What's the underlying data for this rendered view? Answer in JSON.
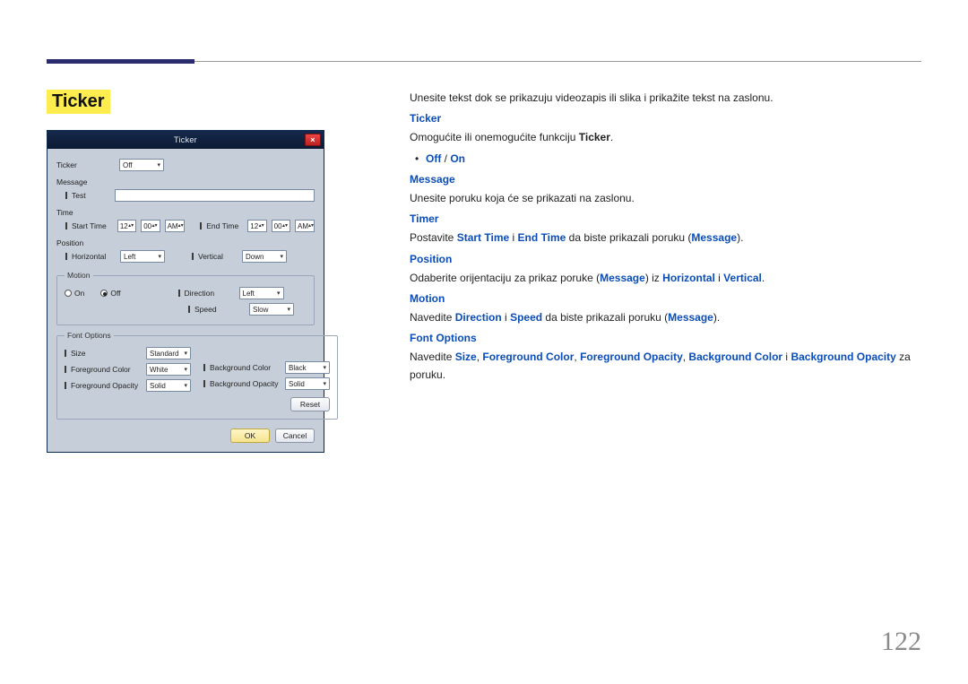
{
  "page_number": "122",
  "heading": "Ticker",
  "dialog": {
    "title": "Ticker",
    "close_glyph": "×",
    "labels": {
      "ticker": "Ticker",
      "message": "Message",
      "test": "Test",
      "time": "Time",
      "start_time": "Start Time",
      "end_time": "End Time",
      "position": "Position",
      "horizontal": "Horizontal",
      "vertical": "Vertical",
      "motion": "Motion",
      "on": "On",
      "off": "Off",
      "direction": "Direction",
      "speed": "Speed",
      "font_options": "Font Options",
      "size": "Size",
      "fg_color": "Foreground Color",
      "fg_opacity": "Foreground Opacity",
      "bg_color": "Background Color",
      "bg_opacity": "Background Opacity"
    },
    "values": {
      "ticker": "Off",
      "message_text": "",
      "start_hh": "12",
      "start_mm": "00",
      "start_ampm": "AM",
      "end_hh": "12",
      "end_mm": "00",
      "end_ampm": "AM",
      "horizontal": "Left",
      "vertical": "Down",
      "motion_on": false,
      "direction": "Left",
      "speed": "Slow",
      "size": "Standard",
      "fg_color": "White",
      "fg_opacity": "Solid",
      "bg_color": "Black",
      "bg_opacity": "Solid"
    },
    "buttons": {
      "reset": "Reset",
      "ok": "OK",
      "cancel": "Cancel"
    }
  },
  "body": {
    "intro": "Unesite tekst dok se prikazuju videozapis ili slika i prikažite tekst na zaslonu.",
    "ticker_h": "Ticker",
    "ticker_p_pre": "Omogućite ili onemogućite funkciju ",
    "ticker_p_b": "Ticker",
    "off": "Off",
    "on": "On",
    "sep": " / ",
    "message_h": "Message",
    "message_p": "Unesite poruku koja će se prikazati na zaslonu.",
    "timer_h": "Timer",
    "timer_p_pre": "Postavite ",
    "timer_b1": "Start Time",
    "timer_mid1": " i ",
    "timer_b2": "End Time",
    "timer_mid2": " da biste prikazali poruku (",
    "timer_b3": "Message",
    "timer_post": ").",
    "position_h": "Position",
    "position_pre": "Odaberite orijentaciju za prikaz poruke (",
    "position_b1": "Message",
    "position_mid": ") iz ",
    "position_b2": "Horizontal",
    "position_and": " i ",
    "position_b3": "Vertical",
    "motion_h": "Motion",
    "motion_pre": "Navedite ",
    "motion_b1": "Direction",
    "motion_and": " i ",
    "motion_b2": "Speed",
    "motion_mid": " da biste prikazali poruku (",
    "motion_b3": "Message",
    "motion_post": ").",
    "font_h": "Font Options",
    "font_pre": "Navedite ",
    "font_b1": "Size",
    "font_c1": ", ",
    "font_b2": "Foreground Color",
    "font_c2": ", ",
    "font_b3": "Foreground Opacity",
    "font_c3": ", ",
    "font_b4": "Background Color",
    "font_and": " i ",
    "font_b5": "Background Opacity",
    "font_post": " za poruku.",
    "period": "."
  }
}
